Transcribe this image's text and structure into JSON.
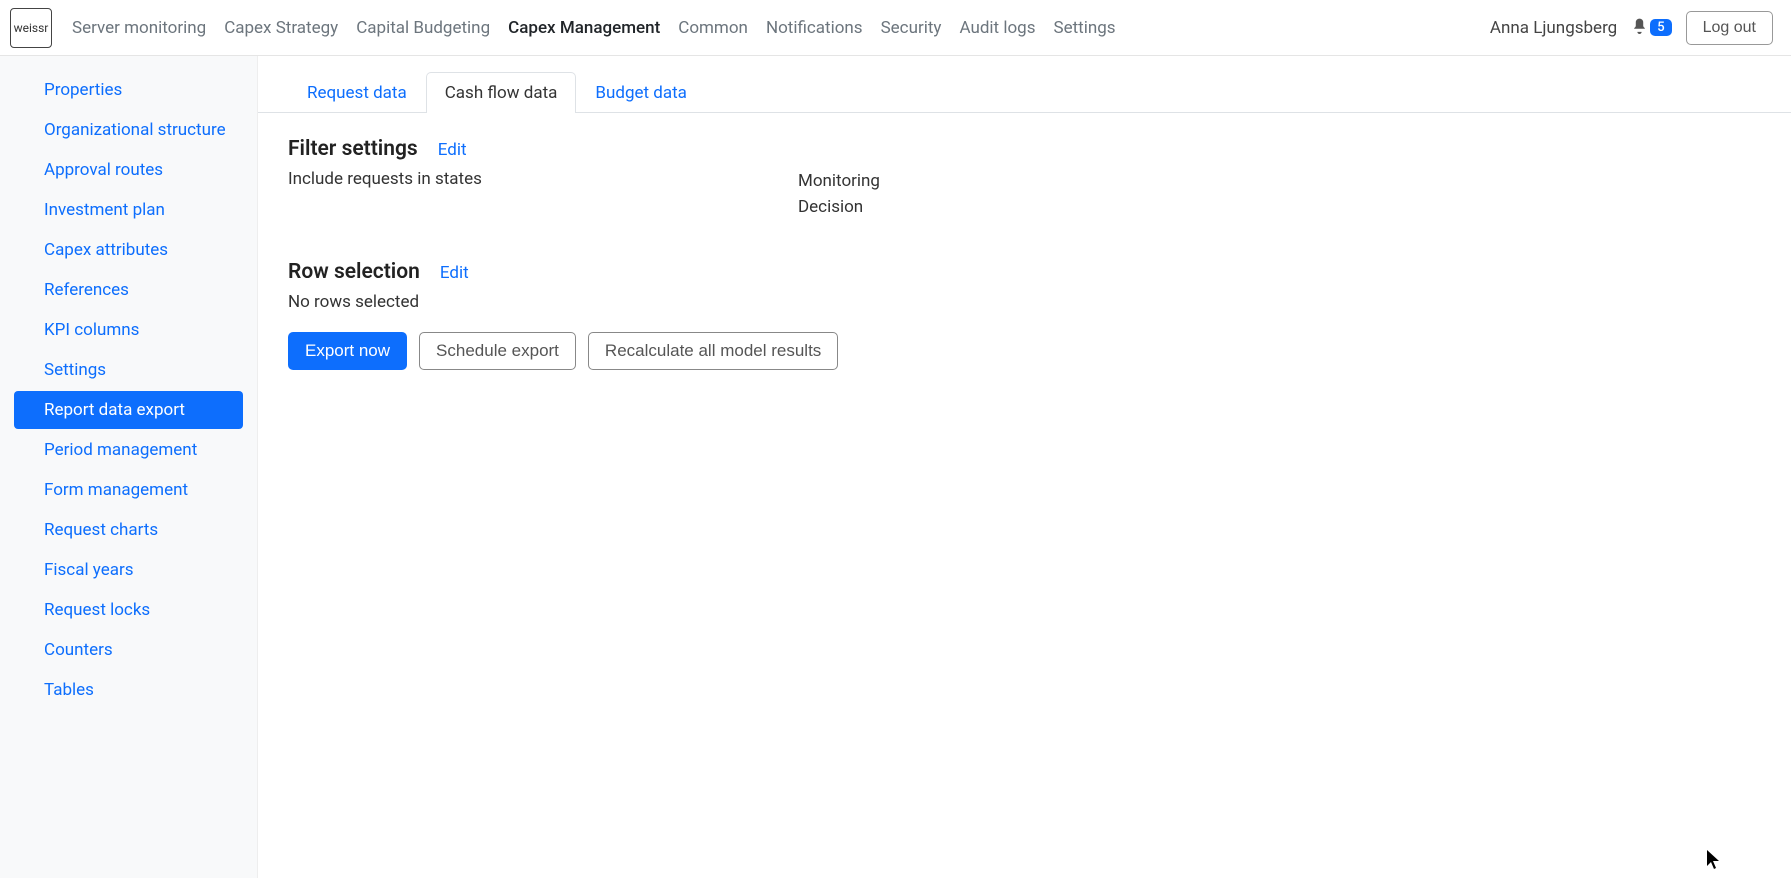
{
  "logo": "weissr",
  "topnav": [
    {
      "label": "Server monitoring",
      "active": false
    },
    {
      "label": "Capex Strategy",
      "active": false
    },
    {
      "label": "Capital Budgeting",
      "active": false
    },
    {
      "label": "Capex Management",
      "active": true
    },
    {
      "label": "Common",
      "active": false
    },
    {
      "label": "Notifications",
      "active": false
    },
    {
      "label": "Security",
      "active": false
    },
    {
      "label": "Audit logs",
      "active": false
    },
    {
      "label": "Settings",
      "active": false
    }
  ],
  "user": {
    "name": "Anna Ljungsberg",
    "notif_count": "5",
    "logout": "Log out"
  },
  "sidebar": [
    {
      "label": "Properties",
      "active": false
    },
    {
      "label": "Organizational structure",
      "active": false
    },
    {
      "label": "Approval routes",
      "active": false
    },
    {
      "label": "Investment plan",
      "active": false
    },
    {
      "label": "Capex attributes",
      "active": false
    },
    {
      "label": "References",
      "active": false
    },
    {
      "label": "KPI columns",
      "active": false
    },
    {
      "label": "Settings",
      "active": false
    },
    {
      "label": "Report data export",
      "active": true
    },
    {
      "label": "Period management",
      "active": false
    },
    {
      "label": "Form management",
      "active": false
    },
    {
      "label": "Request charts",
      "active": false
    },
    {
      "label": "Fiscal years",
      "active": false
    },
    {
      "label": "Request locks",
      "active": false
    },
    {
      "label": "Counters",
      "active": false
    },
    {
      "label": "Tables",
      "active": false
    }
  ],
  "tabs": [
    {
      "label": "Request data",
      "active": false
    },
    {
      "label": "Cash flow data",
      "active": true
    },
    {
      "label": "Budget data",
      "active": false
    }
  ],
  "filter": {
    "title": "Filter settings",
    "edit": "Edit",
    "label": "Include requests in states",
    "values": [
      "Monitoring",
      "Decision"
    ]
  },
  "rowsel": {
    "title": "Row selection",
    "edit": "Edit",
    "text": "No rows selected"
  },
  "buttons": {
    "export": "Export now",
    "schedule": "Schedule export",
    "recalc": "Recalculate all model results"
  }
}
